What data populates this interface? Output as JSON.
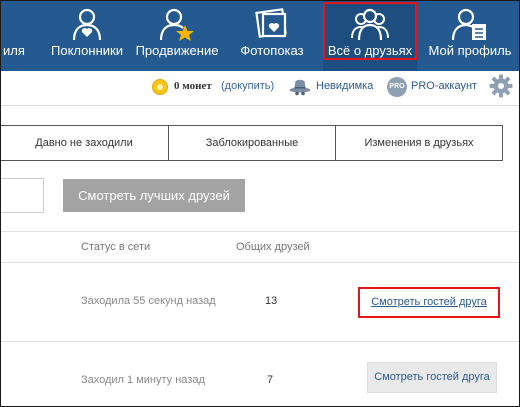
{
  "nav": {
    "items": [
      {
        "label": "иля",
        "icon": "user-icon"
      },
      {
        "label": "Поклонники",
        "icon": "heart-person-icon"
      },
      {
        "label": "Продвижение",
        "icon": "star-person-icon"
      },
      {
        "label": "Фотопоказ",
        "icon": "photo-heart-icon"
      },
      {
        "label": "Всё о друзьях",
        "icon": "friends-group-icon"
      },
      {
        "label": "Мой профиль",
        "icon": "profile-card-icon"
      }
    ],
    "active_index": 4
  },
  "infobar": {
    "coins_text": "0 монет",
    "topup_link": "(докупить)",
    "invisible_label": "Невидимка",
    "pro_badge": "PRO",
    "pro_label": "PRO-аккаунт"
  },
  "tabs": [
    "Давно не заходили",
    "Заблокированные",
    "Изменения в друзьях"
  ],
  "search": {
    "value": ""
  },
  "best_friends_button": "Смотреть лучших друзей",
  "table": {
    "headers": {
      "status": "Статус в сети",
      "common": "Общих друзей"
    },
    "rows": [
      {
        "status": "Заходила 55 секунд назад",
        "common": "13",
        "action": "Смотреть гостей друга"
      },
      {
        "status": "Заходил 1 минуту назад",
        "common": "7",
        "action": "Смотреть гостей друга"
      }
    ]
  },
  "colors": {
    "nav_bg": "#255a91",
    "highlight": "#e3151b",
    "link": "#2b5a8f"
  }
}
